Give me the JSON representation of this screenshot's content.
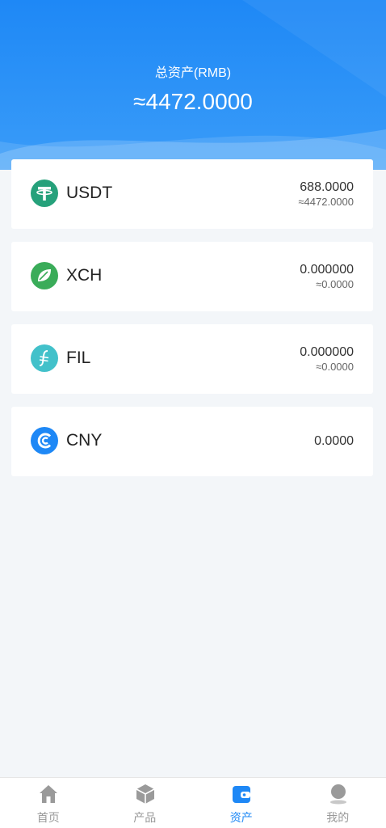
{
  "header": {
    "total_label": "总资产(RMB)",
    "total_value": "≈4472.0000"
  },
  "assets": [
    {
      "name": "USDT",
      "amount": "688.0000",
      "approx": "≈4472.0000",
      "icon": "tether-icon",
      "color": "#26a17b"
    },
    {
      "name": "XCH",
      "amount": "0.000000",
      "approx": "≈0.0000",
      "icon": "leaf-icon",
      "color": "#3aac59"
    },
    {
      "name": "FIL",
      "amount": "0.000000",
      "approx": "≈0.0000",
      "icon": "filecoin-icon",
      "color": "#42c1ca"
    },
    {
      "name": "CNY",
      "amount": "0.0000",
      "icon": "cny-icon",
      "color": "#1e88f6"
    }
  ],
  "tabbar": {
    "items": [
      {
        "label": "首页",
        "icon": "home-icon"
      },
      {
        "label": "产品",
        "icon": "box-icon"
      },
      {
        "label": "资产",
        "icon": "wallet-icon",
        "active": true
      },
      {
        "label": "我的",
        "icon": "user-icon"
      }
    ]
  },
  "colors": {
    "accent": "#1e88f6",
    "inactive": "#999999"
  }
}
